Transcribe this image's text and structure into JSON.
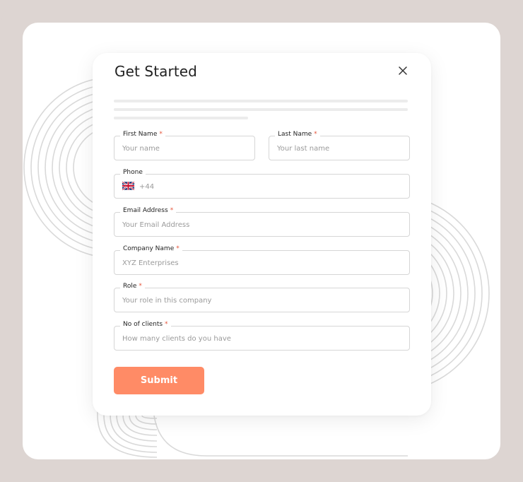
{
  "modal": {
    "title": "Get Started",
    "submit_label": "Submit"
  },
  "fields": {
    "first_name": {
      "label": "First Name",
      "required": "*",
      "placeholder": "Your name"
    },
    "last_name": {
      "label": "Last Name",
      "required": "*",
      "placeholder": "Your last name"
    },
    "phone": {
      "label": "Phone",
      "placeholder": "+44",
      "flag": "uk-flag-icon"
    },
    "email": {
      "label": "Email Address",
      "required": "*",
      "placeholder": "Your Email Address"
    },
    "company": {
      "label": "Company Name",
      "required": "*",
      "placeholder": "XYZ Enterprises"
    },
    "role": {
      "label": "Role",
      "required": "*",
      "placeholder": "Your role in this company"
    },
    "clients": {
      "label": "No of clients",
      "required": "*",
      "placeholder": "How many clients do you have"
    }
  },
  "colors": {
    "frame": "#ddd5d2",
    "accent": "#ff8b66",
    "required": "#e5553b",
    "ring": "#d9d9d9"
  },
  "icons": {
    "close": "close-icon"
  }
}
